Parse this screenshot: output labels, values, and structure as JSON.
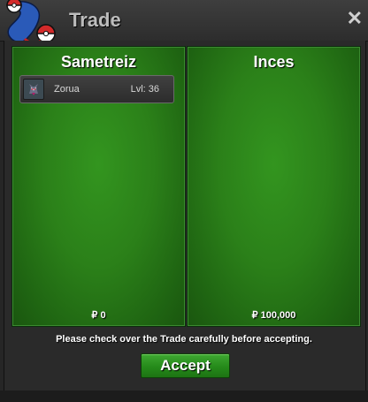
{
  "window": {
    "title": "Trade",
    "close_label": "✕"
  },
  "trade": {
    "left": {
      "player": "Sametreiz",
      "money": "₽ 0",
      "items": [
        {
          "icon": "pokemon-sprite-icon",
          "name": "Zorua",
          "level": "Lvl: 36"
        }
      ]
    },
    "right": {
      "player": "Inces",
      "money": "₽ 100,000",
      "items": []
    },
    "notice": "Please check over the Trade carefully before accepting.",
    "accept_label": "Accept"
  },
  "colors": {
    "panel_green": "#2b8019",
    "button_green": "#258a1a",
    "title_text": "#bdbdbd",
    "background": "#262626"
  }
}
